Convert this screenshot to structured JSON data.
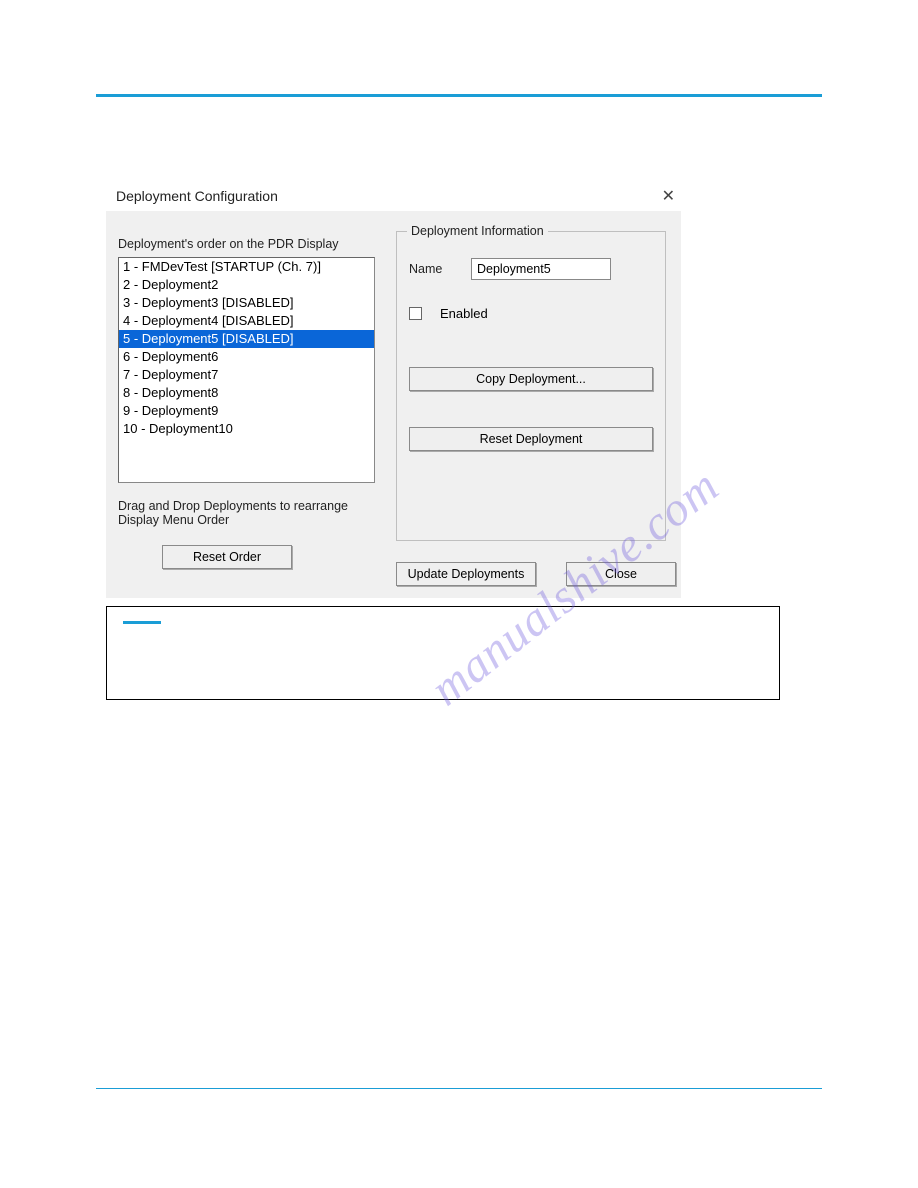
{
  "dialog": {
    "title": "Deployment Configuration",
    "close_glyph": "✕",
    "left": {
      "heading": "Deployment's order on the PDR Display",
      "items": [
        "1 - FMDevTest [STARTUP (Ch. 7)]",
        "2 - Deployment2",
        "3 - Deployment3 [DISABLED]",
        "4 - Deployment4 [DISABLED]",
        "5 - Deployment5 [DISABLED]",
        "6 - Deployment6",
        "7 - Deployment7",
        "8 - Deployment8",
        "9 - Deployment9",
        "10 - Deployment10"
      ],
      "selected_index": 4,
      "drag_hint": "Drag and Drop Deployments to rearrange Display Menu Order",
      "reset_order_label": "Reset Order"
    },
    "right": {
      "legend": "Deployment Information",
      "name_label": "Name",
      "name_value": "Deployment5",
      "enabled_label": "Enabled",
      "enabled_checked": false,
      "copy_label": "Copy Deployment...",
      "reset_label": "Reset Deployment"
    },
    "bottom": {
      "update_label": "Update Deployments",
      "close_label": "Close"
    }
  },
  "watermark_text": "manualshive.com"
}
